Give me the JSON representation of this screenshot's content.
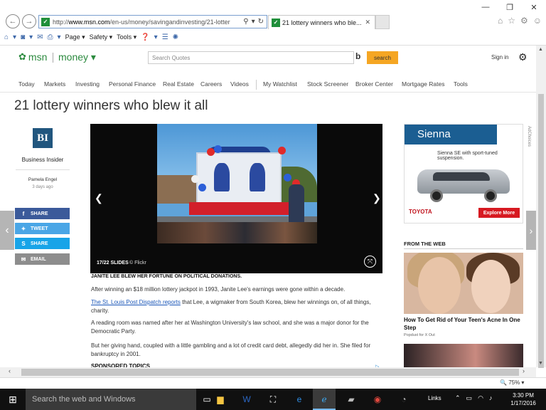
{
  "browser": {
    "url_prefix": "http://",
    "url_domain": "www.msn.com",
    "url_path": "/en-us/money/savingandinvesting/21-lotter",
    "tab_title": "21 lottery winners who ble...",
    "menu": {
      "page": "Page ▾",
      "safety": "Safety ▾",
      "tools": "Tools ▾"
    }
  },
  "msn": {
    "brand": "msn",
    "section": "money ▾",
    "search_placeholder": "Search Quotes",
    "search_button": "search",
    "signin": "Sign in"
  },
  "nav": {
    "items": [
      {
        "label": "Today"
      },
      {
        "label": "Markets"
      },
      {
        "label": "Investing"
      },
      {
        "label": "Personal Finance"
      },
      {
        "label": "Real Estate"
      },
      {
        "label": "Careers"
      },
      {
        "label": "Videos"
      },
      {
        "label": "My Watchlist"
      },
      {
        "label": "Stock Screener"
      },
      {
        "label": "Broker Center"
      },
      {
        "label": "Mortgage Rates"
      },
      {
        "label": "Tools"
      }
    ]
  },
  "article": {
    "title": "21 lottery winners who blew it all",
    "publisher_logo": "BI",
    "publisher": "Business Insider",
    "author": "Pamela Engel",
    "time_ago": "3 days ago",
    "share": {
      "share": "SHARE",
      "tweet": "TWEET",
      "skype": "SHARE",
      "email": "EMAIL"
    },
    "slide_count": "17/22 SLIDES",
    "slide_credit": "© Flickr",
    "subhead": "JANITE LEE BLEW HER FORTUNE ON POLITICAL DONATIONS.",
    "p1": "After winning an $18 million lottery jackpot in 1993, Janite Lee's earnings were gone within a decade.",
    "p2_link": "The St. Louis Post Dispatch reports",
    "p2_rest": " that Lee, a wigmaker from South Korea, blew her winnings on, of all things, charity.",
    "p3": "A reading room was named after her at Washington University's law school, and she was a major donor for the Democratic Party.",
    "p4": "But her giving hand, coupled with a little gambling and a lot of credit card debt, allegedly did her in. She filed for bankruptcy in 2001.",
    "sponsored": "SPONSORED TOPICS"
  },
  "ad": {
    "banner": "Sienna",
    "tagline": "Sienna SE with sport-tuned suspension.",
    "brand": "TOYOTA",
    "button": "Explore More",
    "adchoices": "AdChoices"
  },
  "from_web": {
    "header": "FROM THE WEB",
    "title": "How To Get Rid of Your Teen's Acne In One Step",
    "source": "Popdust for X Out"
  },
  "status": {
    "zoom": "75%"
  },
  "taskbar": {
    "search_placeholder": "Search the web and Windows",
    "links": "Links",
    "time": "3:30 PM",
    "date": "1/17/2016"
  }
}
